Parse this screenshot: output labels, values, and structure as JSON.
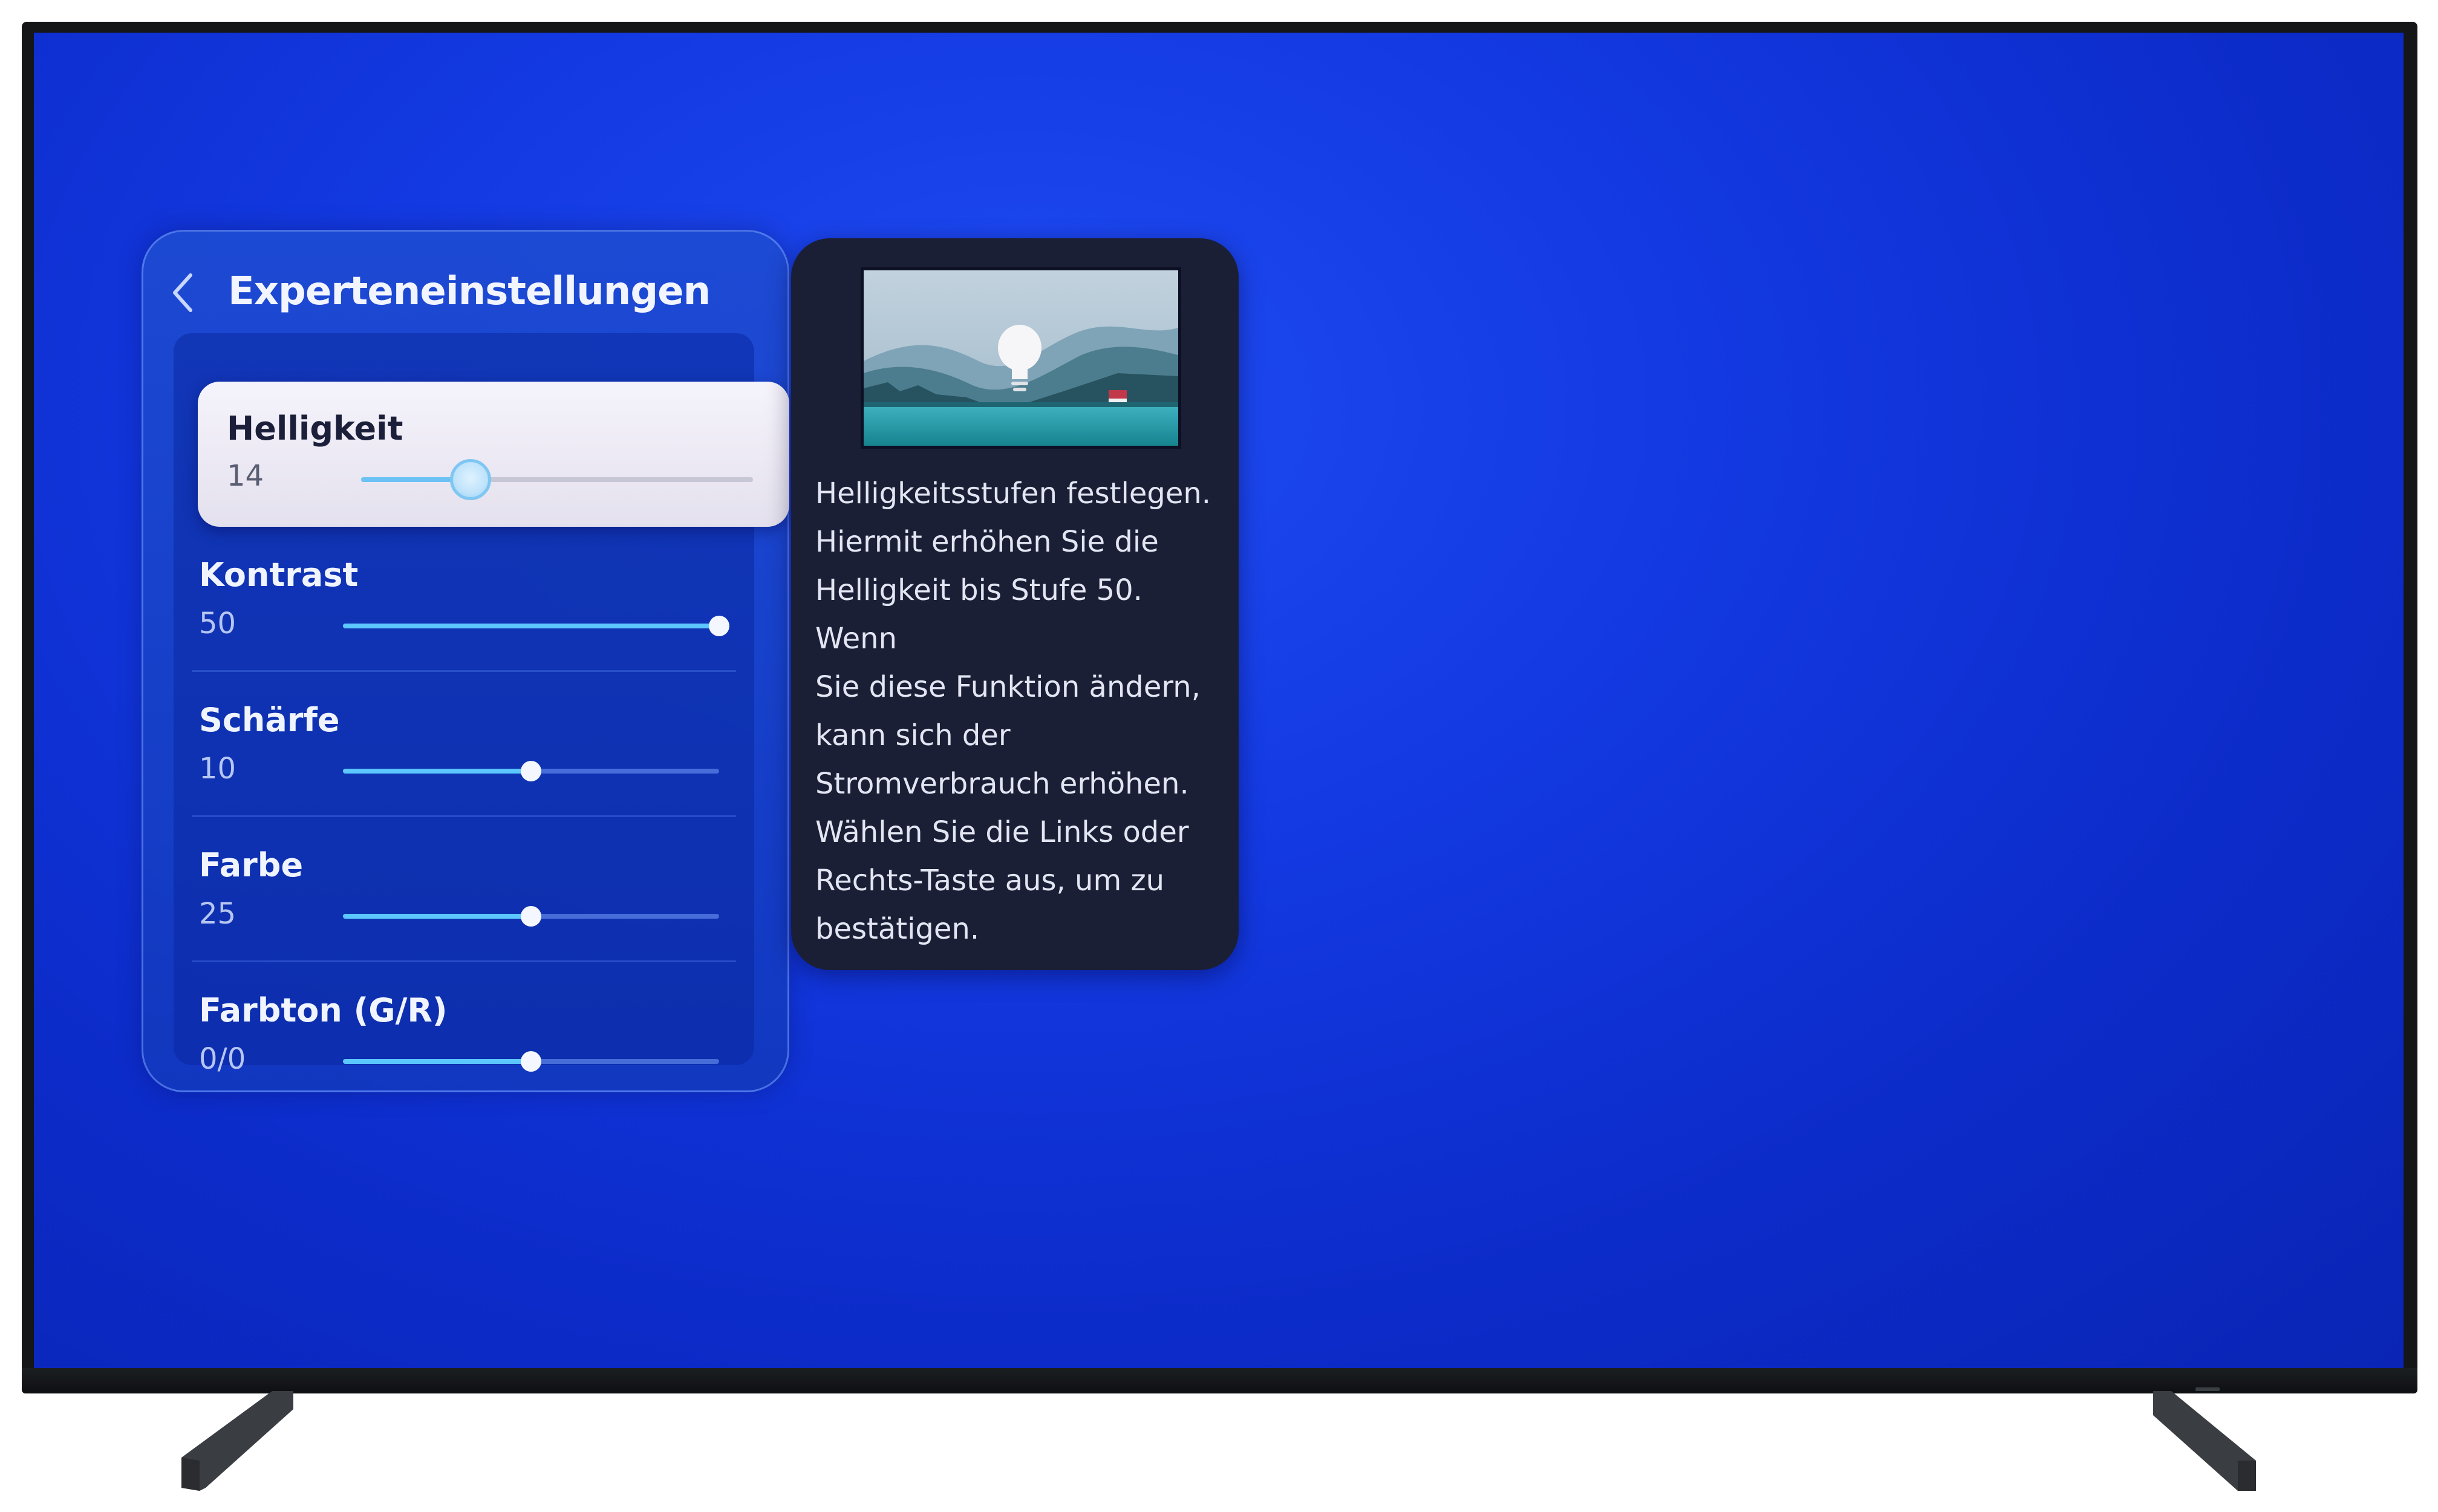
{
  "settings_panel": {
    "title": "Experteneinstellungen",
    "items": [
      {
        "label": "Helligkeit",
        "value": "14",
        "level": 0.28
      },
      {
        "label": "Kontrast",
        "value": "50",
        "level": 1.0
      },
      {
        "label": "Schärfe",
        "value": "10",
        "level": 0.5
      },
      {
        "label": "Farbe",
        "value": "25",
        "level": 0.5
      },
      {
        "label": "Farbton (G/R)",
        "value": "0/0",
        "level": 0.5
      }
    ]
  },
  "info_panel": {
    "description": "Helligkeitsstufen festlegen.\nHiermit erhöhen Sie die\nHelligkeit bis Stufe 50. Wenn\nSie diese Funktion ändern,\nkann sich der\nStromverbrauch erhöhen.\nWählen Sie die Links oder\nRechts-Taste aus, um zu\nbestätigen."
  },
  "icons": {
    "back": "chevron-left-icon",
    "preview": "brightness-lightbulb-landscape-icon"
  },
  "colors": {
    "screen_background": "#1339e2",
    "focused_item_background": "#f0eef6",
    "slider_fill": "#5cc8ff",
    "info_panel_background": "#1b1f36"
  }
}
